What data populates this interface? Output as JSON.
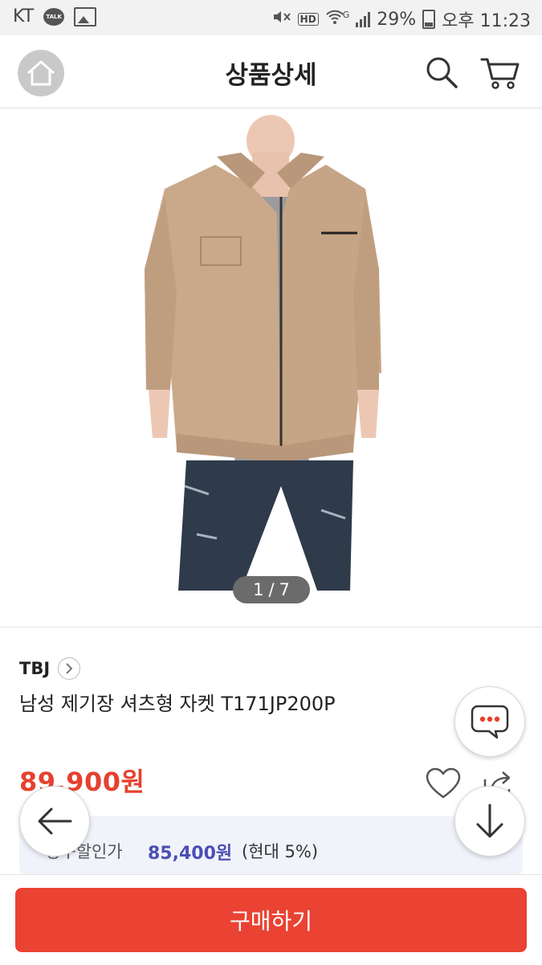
{
  "status_bar": {
    "carrier": "KT",
    "talk_badge": "TALK",
    "hd": "HD",
    "network": "G",
    "battery": "29%",
    "time": "오후 11:23"
  },
  "header": {
    "title": "상품상세"
  },
  "gallery": {
    "current": "1",
    "separator": "/",
    "total": "7"
  },
  "product": {
    "brand": "TBJ",
    "name": "남성 제기장 셔츠형 자켓 T171JP200P",
    "price": "89,900원"
  },
  "discount": {
    "label": "청구할인가",
    "price": "85,400원",
    "card": "(현대 5%)"
  },
  "actions": {
    "buy_label": "구매하기"
  },
  "colors": {
    "accent": "#ea4233",
    "price": "#e5412f",
    "discount_price": "#4b4fb3",
    "discount_bg": "#f1f3fb"
  },
  "icons": [
    "home-icon",
    "search-icon",
    "cart-icon",
    "chevron-right-icon",
    "heart-icon",
    "share-icon",
    "chat-icon",
    "arrow-left-icon",
    "arrow-down-icon"
  ]
}
